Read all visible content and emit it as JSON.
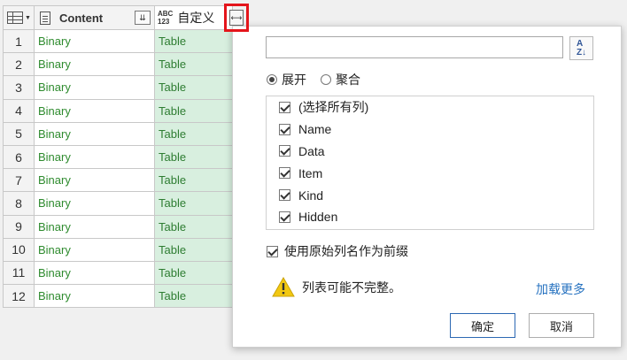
{
  "grid": {
    "columns": {
      "content": "Content",
      "custom": "自定义",
      "custom_type_top": "ABC",
      "custom_type_bottom": "123"
    },
    "rows": [
      {
        "index": "1",
        "content": "Binary",
        "custom": "Table"
      },
      {
        "index": "2",
        "content": "Binary",
        "custom": "Table"
      },
      {
        "index": "3",
        "content": "Binary",
        "custom": "Table"
      },
      {
        "index": "4",
        "content": "Binary",
        "custom": "Table"
      },
      {
        "index": "5",
        "content": "Binary",
        "custom": "Table"
      },
      {
        "index": "6",
        "content": "Binary",
        "custom": "Table"
      },
      {
        "index": "7",
        "content": "Binary",
        "custom": "Table"
      },
      {
        "index": "8",
        "content": "Binary",
        "custom": "Table"
      },
      {
        "index": "9",
        "content": "Binary",
        "custom": "Table"
      },
      {
        "index": "10",
        "content": "Binary",
        "custom": "Table"
      },
      {
        "index": "11",
        "content": "Binary",
        "custom": "Table"
      },
      {
        "index": "12",
        "content": "Binary",
        "custom": "Table"
      }
    ]
  },
  "popup": {
    "search_value": "",
    "radio": {
      "expand": "展开",
      "aggregate": "聚合",
      "selected": "expand"
    },
    "columns": [
      {
        "label": "(选择所有列)",
        "checked": true
      },
      {
        "label": "Name",
        "checked": true
      },
      {
        "label": "Data",
        "checked": true
      },
      {
        "label": "Item",
        "checked": true
      },
      {
        "label": "Kind",
        "checked": true
      },
      {
        "label": "Hidden",
        "checked": true
      }
    ],
    "prefix_label": "使用原始列名作为前缀",
    "prefix_checked": true,
    "warning": "列表可能不完整。",
    "load_more": "加载更多",
    "ok": "确定",
    "cancel": "取消"
  },
  "colors": {
    "highlight": "#e4151b",
    "content_text": "#2e8b2e",
    "custom_bg": "#d8efdf",
    "link": "#2672c0"
  }
}
